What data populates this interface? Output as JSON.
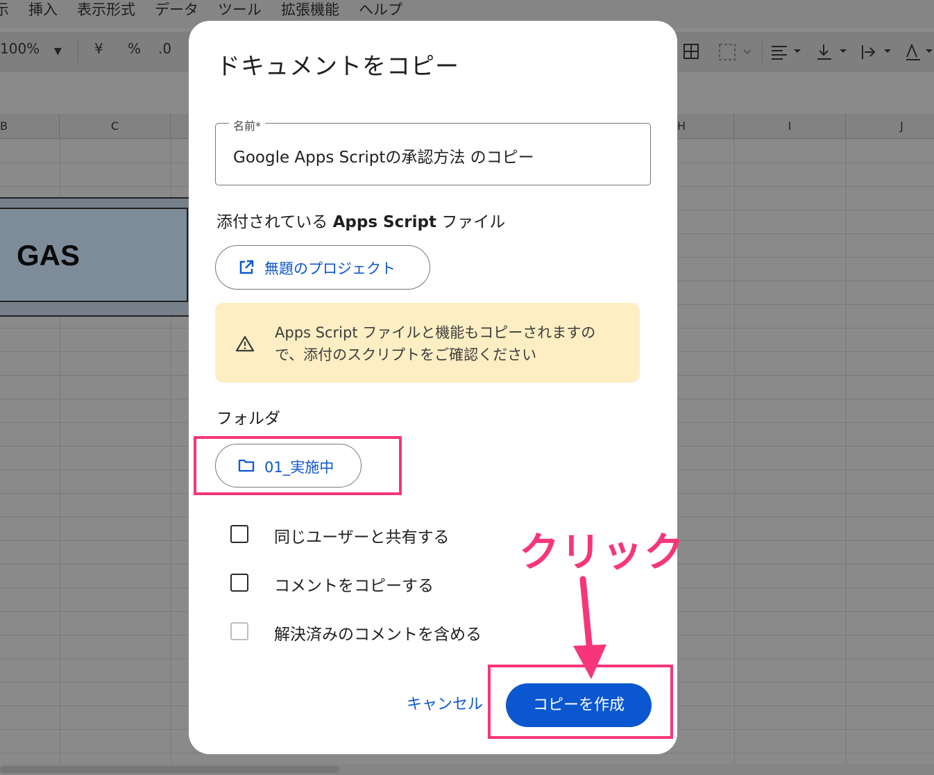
{
  "menubar": {
    "items": [
      "示",
      "挿入",
      "表示形式",
      "データ",
      "ツール",
      "拡張機能",
      "ヘルプ"
    ]
  },
  "toolbar": {
    "zoom": "100%",
    "currency": "¥",
    "percent": "%",
    "decimal": ".0"
  },
  "columns": [
    "B",
    "C",
    "H",
    "I",
    "J"
  ],
  "cell_text": "GAS",
  "dialog": {
    "title": "ドキュメントをコピー",
    "name_label": "名前*",
    "name_value": "Google Apps Scriptの承認方法 のコピー",
    "script_section_prefix": "添付されている ",
    "script_section_bold": "Apps Script",
    "script_section_suffix": " ファイル",
    "script_project": "無題のプロジェクト",
    "warning": "Apps Script ファイルと機能もコピーされますので、添付のスクリプトをご確認ください",
    "folder_label": "フォルダ",
    "folder_name": "01_実施中",
    "checkboxes": [
      {
        "label": "同じユーザーと共有する",
        "checked": false,
        "enabled": true
      },
      {
        "label": "コメントをコピーする",
        "checked": false,
        "enabled": true
      },
      {
        "label": "解決済みのコメントを含める",
        "checked": false,
        "enabled": false
      }
    ],
    "cancel_label": "キャンセル",
    "create_label": "コピーを作成"
  },
  "annotation": {
    "click_text": "クリック",
    "color": "#f7357a"
  },
  "colors": {
    "accent": "#0b57d0",
    "warning_bg": "#fdefc3"
  }
}
